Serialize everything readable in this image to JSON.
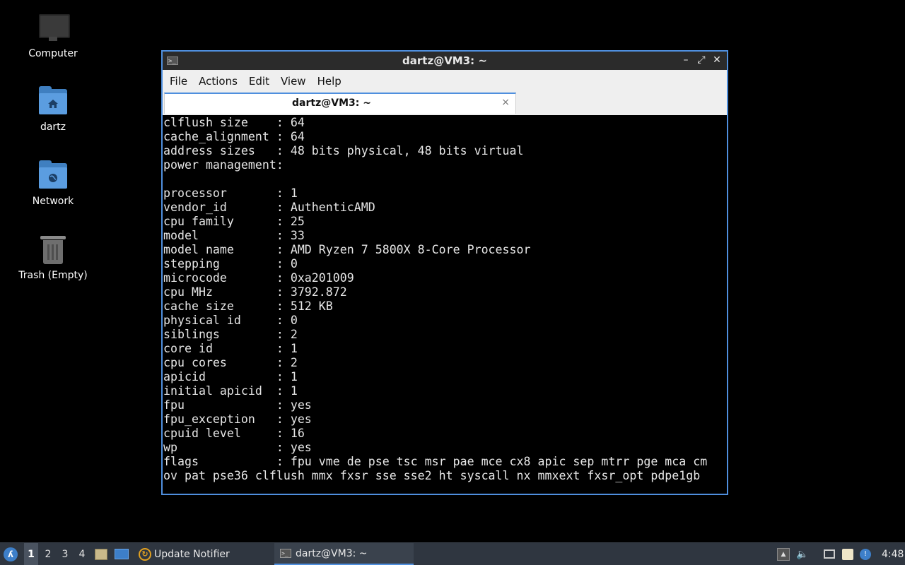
{
  "desktop": {
    "icons": [
      {
        "label": "Computer",
        "icon": "computer-icon"
      },
      {
        "label": "dartz",
        "icon": "home-folder-icon"
      },
      {
        "label": "Network",
        "icon": "network-folder-icon"
      },
      {
        "label": "Trash (Empty)",
        "icon": "trash-icon"
      }
    ]
  },
  "window": {
    "title": "dartz@VM3: ~",
    "controls": {
      "minimize": "–",
      "maximize": "⤢",
      "close": "✕"
    },
    "menu": [
      "File",
      "Actions",
      "Edit",
      "View",
      "Help"
    ],
    "tab": {
      "title": "dartz@VM3: ~",
      "close": "×"
    },
    "terminal_lines": [
      "clflush size    : 64",
      "cache_alignment : 64",
      "address sizes   : 48 bits physical, 48 bits virtual",
      "power management:",
      "",
      "processor       : 1",
      "vendor_id       : AuthenticAMD",
      "cpu family      : 25",
      "model           : 33",
      "model name      : AMD Ryzen 7 5800X 8-Core Processor",
      "stepping        : 0",
      "microcode       : 0xa201009",
      "cpu MHz         : 3792.872",
      "cache size      : 512 KB",
      "physical id     : 0",
      "siblings        : 2",
      "core id         : 1",
      "cpu cores       : 2",
      "apicid          : 1",
      "initial apicid  : 1",
      "fpu             : yes",
      "fpu_exception   : yes",
      "cpuid level     : 16",
      "wp              : yes",
      "flags           : fpu vme de pse tsc msr pae mce cx8 apic sep mtrr pge mca cm",
      "ov pat pse36 clflush mmx fxsr sse sse2 ht syscall nx mmxext fxsr_opt pdpe1gb"
    ]
  },
  "taskbar": {
    "workspaces": [
      "1",
      "2",
      "3",
      "4"
    ],
    "active_workspace": "1",
    "tasks": [
      {
        "label": "Update Notifier",
        "icon": "update-notifier-icon"
      },
      {
        "label": "dartz@VM3: ~",
        "icon": "terminal-icon"
      }
    ],
    "clock": "4:48"
  },
  "colors": {
    "accent": "#4f8fde",
    "taskbar": "#2f3640",
    "desktop": "#000000"
  }
}
